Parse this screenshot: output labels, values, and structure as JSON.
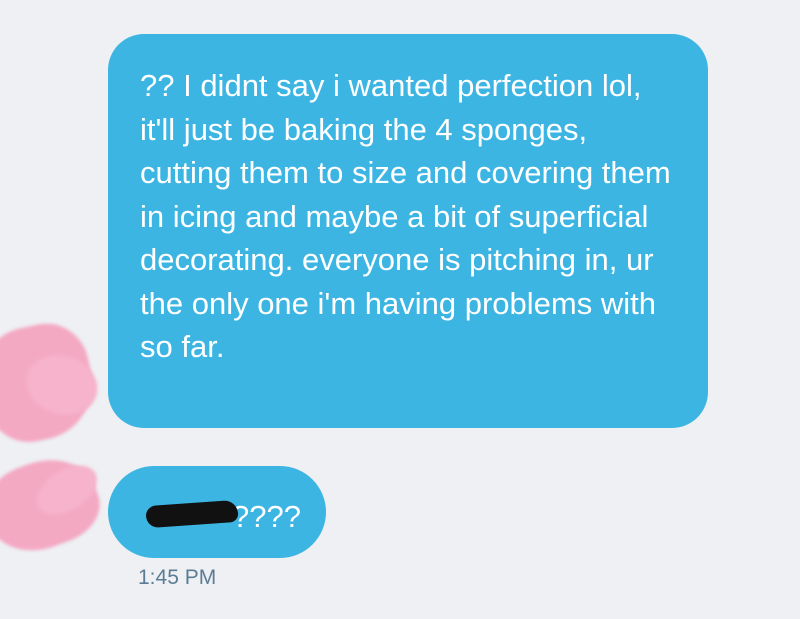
{
  "conversation": {
    "messages": [
      {
        "text": "?? I didnt say i wanted perfection lol, it'll just be baking the 4 sponges, cutting them to size and covering them in icing and maybe a bit of superficial decorating. everyone is pitching in, ur the only one i'm having problems with so far."
      },
      {
        "text": "????"
      }
    ],
    "timestamp": "1:45 PM"
  },
  "colors": {
    "background": "#eef0f3",
    "bubble": "#3db5e3",
    "bubble_text": "#ffffff",
    "timestamp_text": "#5a7d95",
    "avatar_scribble": "#f4a9c3",
    "redaction": "#111111"
  }
}
